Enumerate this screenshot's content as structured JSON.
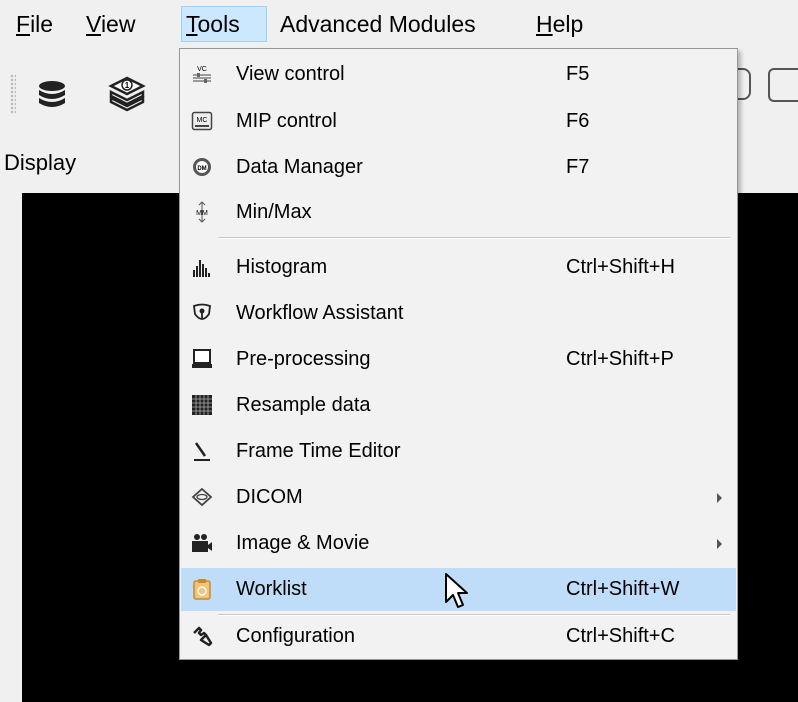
{
  "menubar": {
    "file": "ile",
    "file_mn": "F",
    "view": "iew",
    "view_mn": "V",
    "tools": "ools",
    "tools_mn": "T",
    "advanced": "Advanced Modules",
    "help": "elp",
    "help_mn": "H"
  },
  "display": {
    "label": "Display"
  },
  "tools_menu": {
    "items": [
      {
        "label": "View control",
        "shortcut": "F5",
        "icon": "view-control-icon"
      },
      {
        "label": "MIP control",
        "shortcut": "F6",
        "icon": "mip-control-icon"
      },
      {
        "label": "Data Manager",
        "shortcut": "F7",
        "icon": "data-manager-icon"
      },
      {
        "label": "Min/Max",
        "shortcut": "",
        "icon": "min-max-icon"
      },
      {
        "label": "Histogram",
        "shortcut": "Ctrl+Shift+H",
        "icon": "histogram-icon"
      },
      {
        "label": "Workflow Assistant",
        "shortcut": "",
        "icon": "workflow-assistant-icon"
      },
      {
        "label": "Pre-processing",
        "shortcut": "Ctrl+Shift+P",
        "icon": "pre-processing-icon"
      },
      {
        "label": "Resample data",
        "shortcut": "",
        "icon": "resample-data-icon"
      },
      {
        "label": "Frame Time Editor",
        "shortcut": "",
        "icon": "frame-time-editor-icon"
      },
      {
        "label": "DICOM",
        "shortcut": "",
        "icon": "dicom-icon",
        "submenu": true
      },
      {
        "label": "Image & Movie",
        "shortcut": "",
        "icon": "image-movie-icon",
        "submenu": true
      },
      {
        "label": "Worklist",
        "shortcut": "Ctrl+Shift+W",
        "icon": "worklist-icon",
        "highlighted": true
      },
      {
        "label": "Configuration",
        "shortcut": "Ctrl+Shift+C",
        "icon": "wrench-icon"
      }
    ]
  },
  "colors": {
    "highlight": "#bfdcf8",
    "menu_active": "#cce8ff",
    "display_bg": "#000000"
  }
}
